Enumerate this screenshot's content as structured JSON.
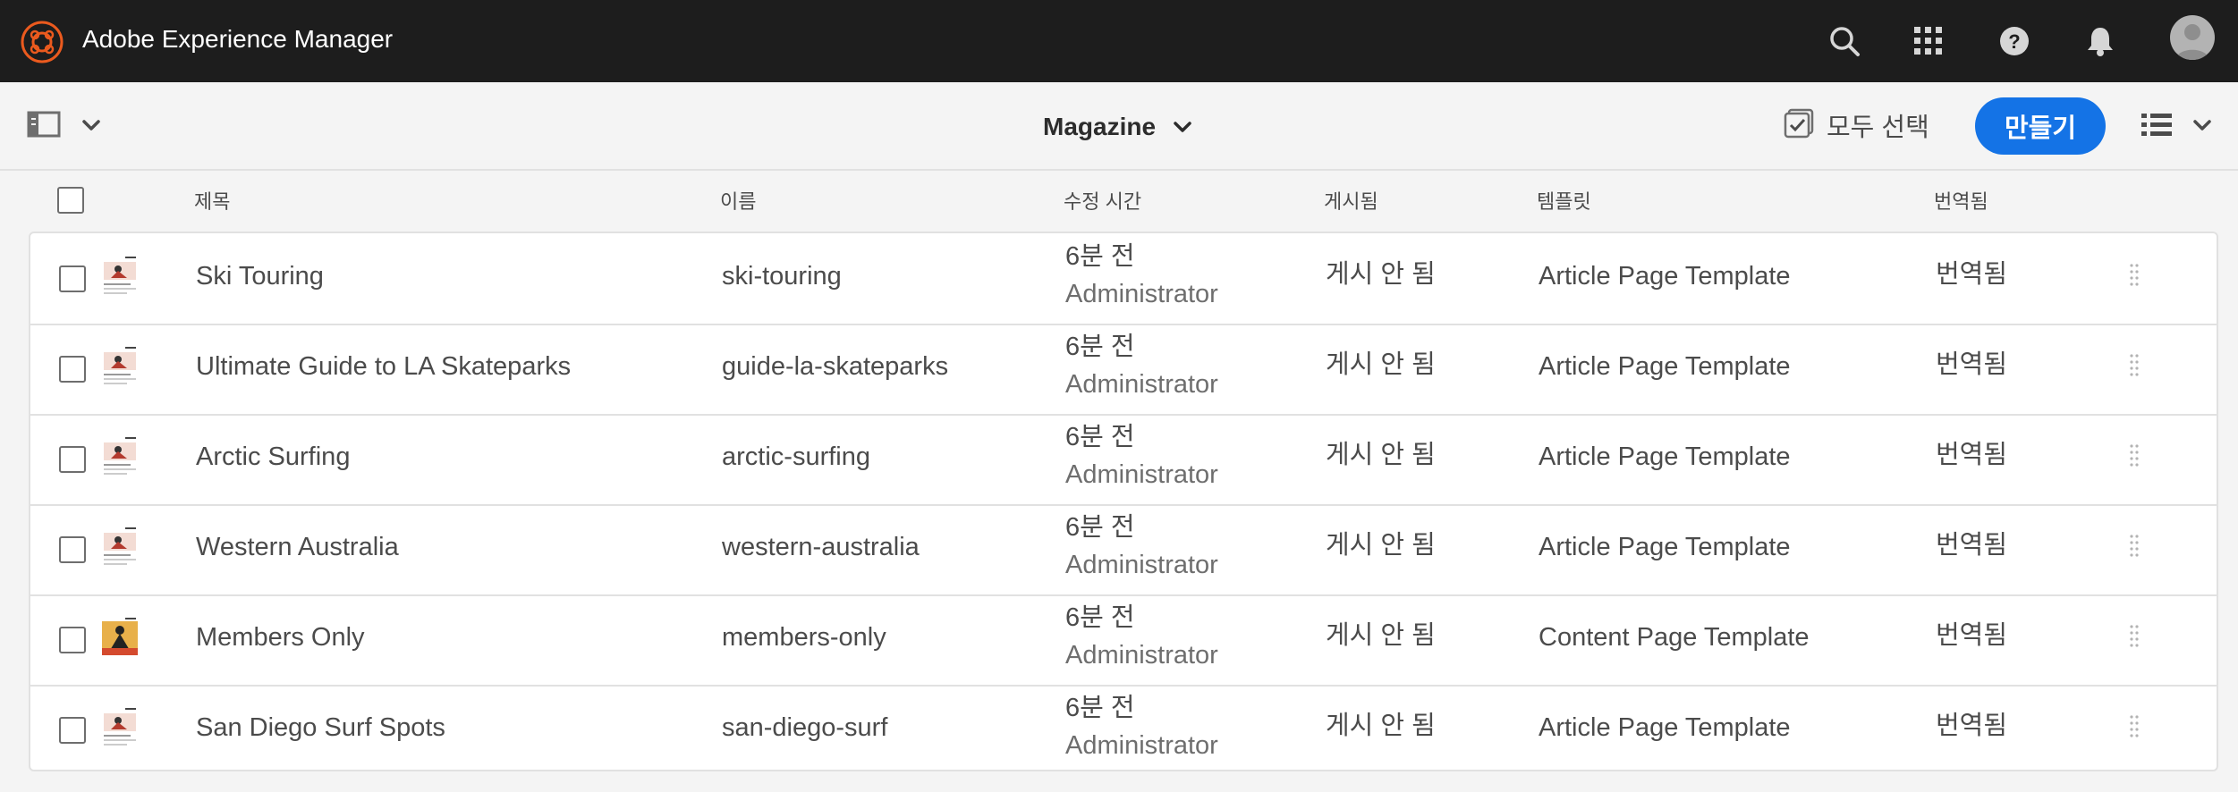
{
  "shell": {
    "title": "Adobe Experience Manager",
    "icons": [
      "search-icon",
      "apps-grid-icon",
      "help-icon",
      "bell-icon",
      "avatar"
    ],
    "colors": {
      "bar": "#1d1d1d",
      "logo": "#eb5a1e"
    }
  },
  "actionbar": {
    "breadcrumb": "Magazine",
    "select_all_label": "모두 선택",
    "create_label": "만들기",
    "colors": {
      "create": "#1473e6"
    }
  },
  "table": {
    "columns": {
      "title": "제목",
      "name": "이름",
      "modified": "수정 시간",
      "published": "게시됨",
      "template": "템플릿",
      "translated": "번역됨"
    },
    "rows": [
      {
        "title": "Ski Touring",
        "name": "ski-touring",
        "mod_time": "6분 전",
        "mod_user": "Administrator",
        "published": "게시 안 됨",
        "template": "Article Page Template",
        "translated": "번역됨"
      },
      {
        "title": "Ultimate Guide to LA Skateparks",
        "name": "guide-la-skateparks",
        "mod_time": "6분 전",
        "mod_user": "Administrator",
        "published": "게시 안 됨",
        "template": "Article Page Template",
        "translated": "번역됨"
      },
      {
        "title": "Arctic Surfing",
        "name": "arctic-surfing",
        "mod_time": "6분 전",
        "mod_user": "Administrator",
        "published": "게시 안 됨",
        "template": "Article Page Template",
        "translated": "번역됨"
      },
      {
        "title": "Western Australia",
        "name": "western-australia",
        "mod_time": "6분 전",
        "mod_user": "Administrator",
        "published": "게시 안 됨",
        "template": "Article Page Template",
        "translated": "번역됨"
      },
      {
        "title": "Members Only",
        "name": "members-only",
        "mod_time": "6분 전",
        "mod_user": "Administrator",
        "published": "게시 안 됨",
        "template": "Content Page Template",
        "translated": "번역됨"
      },
      {
        "title": "San Diego Surf Spots",
        "name": "san-diego-surf",
        "mod_time": "6분 전",
        "mod_user": "Administrator",
        "published": "게시 안 됨",
        "template": "Article Page Template",
        "translated": "번역됨"
      }
    ]
  }
}
